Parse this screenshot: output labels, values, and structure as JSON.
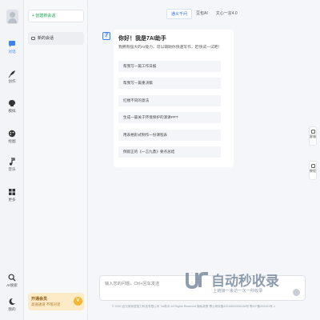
{
  "rail": {
    "items": [
      {
        "label": "对话",
        "icon": "chat-icon"
      },
      {
        "label": "创作",
        "icon": "feather-icon"
      },
      {
        "label": "模拟",
        "icon": "head-icon"
      },
      {
        "label": "绘图",
        "icon": "palette-icon"
      },
      {
        "label": "音乐",
        "icon": "music-note-icon"
      },
      {
        "label": "更多",
        "icon": "grid-icon"
      }
    ],
    "bottom": [
      {
        "label": "AI搜索",
        "icon": "search-icon"
      },
      {
        "label": "我的",
        "icon": "moon-icon"
      }
    ]
  },
  "panel": {
    "new_chat": "+ 创建新会话",
    "history": [
      "新的会话"
    ],
    "promo_title": "开通会员",
    "promo_sub": "高速通道 不限对话",
    "promo_badge": "V"
  },
  "tabs": [
    {
      "label": "通义千问",
      "active": true
    },
    {
      "label": "豆包AI",
      "active": false
    },
    {
      "label": "文心一言4.0",
      "active": false
    }
  ],
  "assistant": {
    "greeting": "你好！我是7AI助手",
    "intro": "我拥有强大的AI能力，可以辅助你快速写作，赶快试一试吧！",
    "suggestions": [
      "帮我写一篇工作日报",
      "帮我写一篇重决稿",
      "红楼不同的意法",
      "生成一篇关于环境保护的演讲PPT",
      "用表格形式制作一份课程表",
      "倒叙正的《一言九鼎》要点总结"
    ]
  },
  "input": {
    "placeholder": "输入您的问题，Ctrl+回车发送"
  },
  "footer": "© 2022 武汉家家居智力科技有限公司 7aI助手 All Rights Reserved 隐私政策    鄂公网安备42018502006138号    鄂ICP备202401号-1",
  "float_buttons": [
    {
      "label": "客服",
      "icon": "headset-icon"
    },
    {
      "label": "教程",
      "icon": "book-icon"
    }
  ],
  "watermark": {
    "title": "自动秒收录",
    "subtitle": "上链接一来访一次一秒收录"
  },
  "colors": {
    "accent": "#3b82f6",
    "new_chat_green": "#16a34a",
    "promo_bg": "#fdebc8"
  }
}
